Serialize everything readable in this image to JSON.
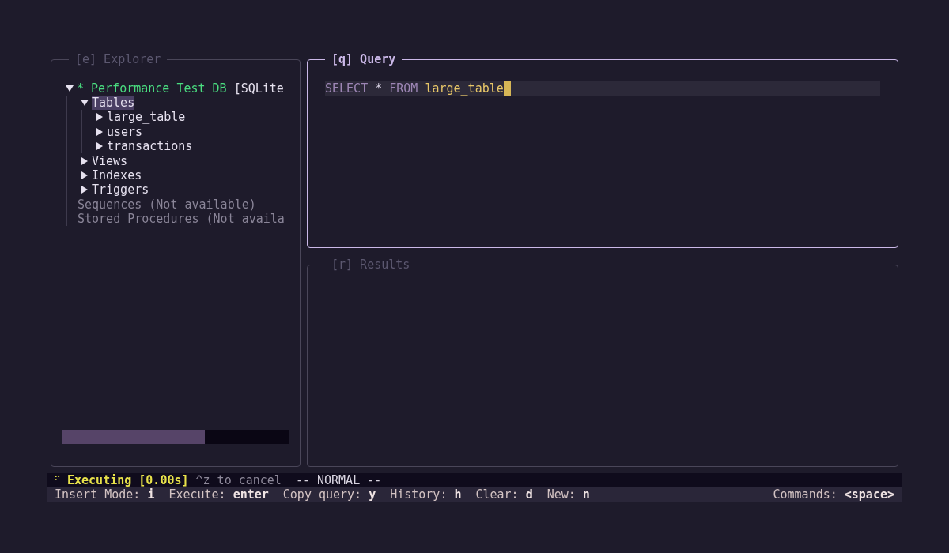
{
  "explorer": {
    "title": "[e] Explorer",
    "focused": false,
    "tree": [
      {
        "marker": "*",
        "label": "Performance Test DB",
        "suffix": "[SQLite",
        "kind": "database",
        "expanded": true,
        "selected": false,
        "children": [
          {
            "label": "Tables",
            "expanded": true,
            "selected": true,
            "children": [
              {
                "label": "large_table",
                "expanded": false,
                "selected": false
              },
              {
                "label": "users",
                "expanded": false,
                "selected": false
              },
              {
                "label": "transactions",
                "expanded": false,
                "selected": false
              }
            ]
          },
          {
            "label": "Views",
            "expanded": false,
            "selected": false
          },
          {
            "label": "Indexes",
            "expanded": false,
            "selected": false
          },
          {
            "label": "Triggers",
            "expanded": false,
            "selected": false
          },
          {
            "label": "Sequences (Not available)",
            "kind": "unavailable",
            "selected": false
          },
          {
            "label": "Stored Procedures (Not availa",
            "kind": "unavailable",
            "selected": false
          }
        ]
      }
    ],
    "progress": {
      "level": 0.63
    }
  },
  "query": {
    "title": "[q] Query",
    "focused": true,
    "tokens": [
      {
        "text": "SELECT",
        "kind": "keyword"
      },
      {
        "text": " * ",
        "kind": "operator"
      },
      {
        "text": "FROM",
        "kind": "keyword"
      },
      {
        "text": " large_table",
        "kind": "identifier"
      }
    ],
    "cursor": true
  },
  "results": {
    "title": "[r] Results",
    "focused": false
  },
  "status_bar": {
    "spinner": "⠋",
    "state": "Executing [0.00s]",
    "hint": "^z to cancel",
    "mode": "-- NORMAL --"
  },
  "key_hints": [
    {
      "label": "Insert Mode:",
      "key": "i"
    },
    {
      "label": "Execute:",
      "key": "enter"
    },
    {
      "label": "Copy query:",
      "key": "y"
    },
    {
      "label": "History:",
      "key": "h"
    },
    {
      "label": "Clear:",
      "key": "d"
    },
    {
      "label": "New:",
      "key": "n"
    }
  ],
  "commands_hint": {
    "label": "Commands:",
    "key": "<space>"
  }
}
